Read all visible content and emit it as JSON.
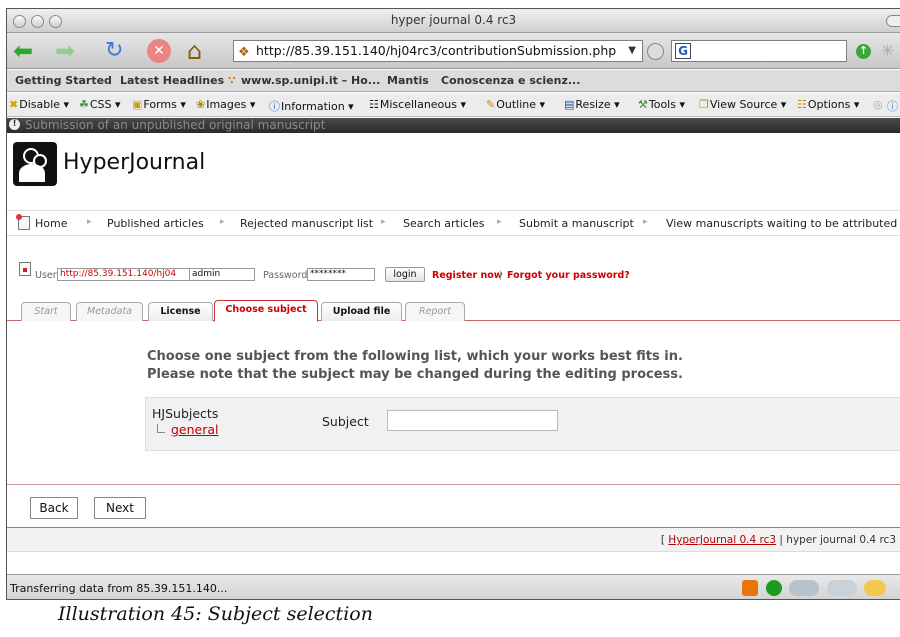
{
  "window": {
    "title": "hyper journal 0.4 rc3"
  },
  "toolbar": {
    "url": "http://85.39.151.140/hj04rc3/contributionSubmission.php",
    "search_value": ""
  },
  "bookmarks": [
    "Getting Started",
    "Latest Headlines",
    "www.sp.unipi.it – Ho...",
    "Mantis",
    "Conoscenza e scienz..."
  ],
  "devbar": {
    "items": [
      "Disable",
      "CSS",
      "Forms",
      "Images",
      "Information",
      "Miscellaneous",
      "Outline",
      "Resize",
      "Tools",
      "View Source",
      "Options"
    ]
  },
  "page": {
    "header_title": "Submission of an unpublished original manuscript",
    "site_name": "HyperJournal",
    "menu": [
      "Home",
      "Published articles",
      "Rejected manuscript list",
      "Search articles",
      "Submit a manuscript",
      "View manuscripts waiting to be attributed"
    ],
    "login": {
      "user_label": "User",
      "url_value": "http://85.39.151.140/hj04",
      "user_value": "admin",
      "password_label": "Password",
      "password_value": "********",
      "login_button": "login",
      "register": "Register now",
      "separator": "|",
      "forgot": "Forgot your password?"
    },
    "tabs": [
      {
        "label": "Start",
        "state": "disabled"
      },
      {
        "label": "Metadata",
        "state": "disabled"
      },
      {
        "label": "License",
        "state": "enabled"
      },
      {
        "label": "Choose subject",
        "state": "active"
      },
      {
        "label": "Upload file",
        "state": "enabled"
      },
      {
        "label": "Report",
        "state": "disabled"
      }
    ],
    "instruction_line1": "Choose one subject from the following list, which your works best fits in.",
    "instruction_line2": "Please note that the subject may be changed during the editing process.",
    "subjects_root": "HJSubjects",
    "subject_item": "general",
    "subject_label": "Subject",
    "subject_value": "",
    "back_button": "Back",
    "next_button": "Next",
    "footer_open": "[",
    "footer_link": "HyperJournal 0.4 rc3",
    "footer_rest": "| hyper journal 0.4 rc3"
  },
  "status": {
    "text": "Transferring data from 85.39.151.140..."
  },
  "caption": "Illustration 45: Subject selection",
  "colors": {
    "accent": "#cc0000",
    "link": "#b00000"
  }
}
